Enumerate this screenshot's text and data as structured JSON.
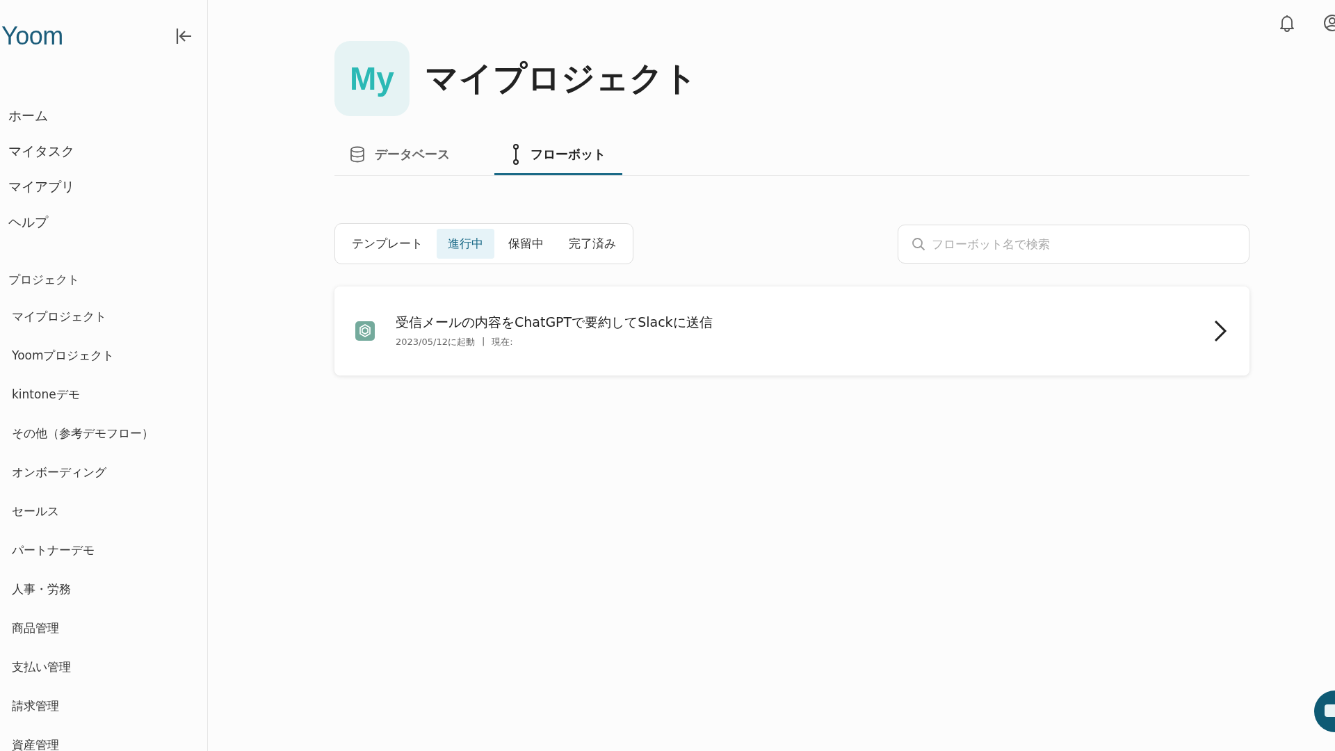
{
  "sidebar": {
    "logo": "Yoom",
    "nav_items": [
      "ホーム",
      "マイタスク",
      "マイアプリ",
      "ヘルプ"
    ],
    "projects_heading": "プロジェクト",
    "projects": [
      "マイプロジェクト",
      "Yoomプロジェクト",
      "kintoneデモ",
      "その他（参考デモフロー）",
      "オンボーディング",
      "セールス",
      "パートナーデモ",
      "人事・労務",
      "商品管理",
      "支払い管理",
      "請求管理",
      "資産管理"
    ]
  },
  "header": {
    "avatar_text": "My",
    "title": "マイプロジェクト"
  },
  "tabs": [
    {
      "label": "データベース",
      "kind": "database",
      "selected": false
    },
    {
      "label": "フローボット",
      "kind": "flow",
      "selected": true
    }
  ],
  "filters": [
    {
      "label": "テンプレート",
      "selected": false
    },
    {
      "label": "進行中",
      "selected": true
    },
    {
      "label": "保留中",
      "selected": false
    },
    {
      "label": "完了済み",
      "selected": false
    }
  ],
  "search": {
    "placeholder": "フローボット名で検索"
  },
  "flows": [
    {
      "title": "受信メールの内容をChatGPTで要約してSlackに送信",
      "started": "2023/05/12に起動",
      "separator": "|",
      "current": "現在:"
    }
  ]
}
